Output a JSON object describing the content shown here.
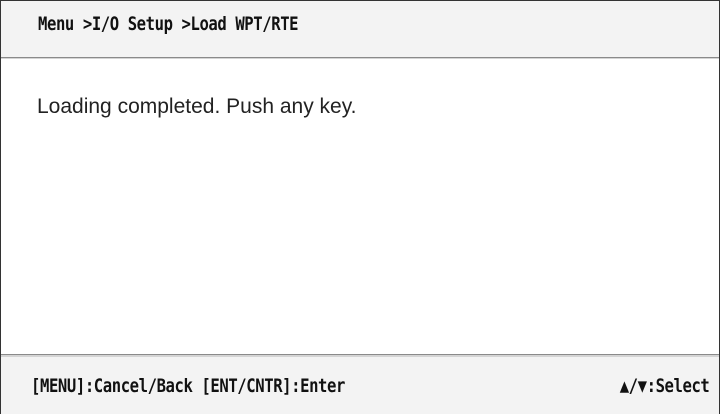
{
  "header": {
    "breadcrumb": "Menu >I/O Setup >Load WPT/RTE"
  },
  "main": {
    "message": "Loading completed. Push any key."
  },
  "footer": {
    "hint_left": "[MENU]:Cancel/Back [ENT/CNTR]:Enter",
    "hint_right": "▲/▼:Select"
  }
}
